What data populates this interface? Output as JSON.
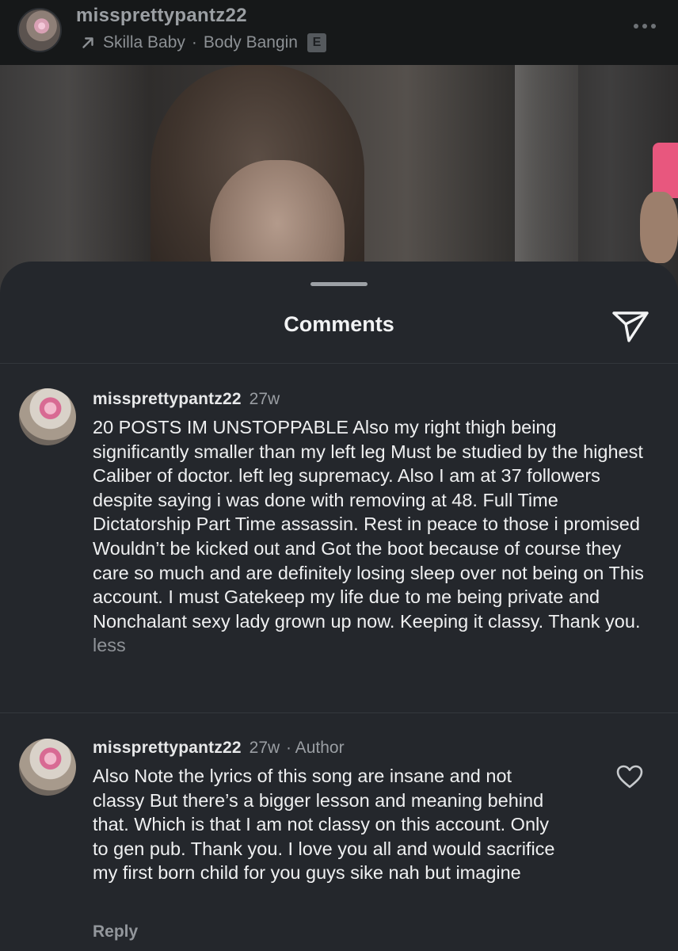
{
  "post": {
    "username": "missprettypantz22",
    "music_artist": "Skilla Baby",
    "music_separator": "·",
    "music_title": "Body Bangin",
    "explicit_badge": "E",
    "icons": {
      "music": "arrow-up-right-icon",
      "more": "more-horizontal-icon"
    }
  },
  "sheet": {
    "title": "Comments",
    "share_icon": "paper-plane-icon"
  },
  "comments": [
    {
      "username": "missprettypantz22",
      "time": "27w",
      "author_tag": "",
      "text": "20 POSTS IM UNSTOPPABLE Also my right thigh being significantly smaller than my left leg Must be studied by the highest Caliber of doctor. left leg supremacy. Also I am at 37 followers despite saying i was done with removing at 48. Full Time Dictatorship Part Time assassin. Rest in peace to those i promised Wouldn’t be kicked out and Got the boot because of course they care so much and are definitely losing sleep over not being on This account. I must Gatekeep my life due to me being private and Nonchalant sexy lady grown up now. Keeping it classy. Thank you.",
      "less_label": "less"
    },
    {
      "username": "missprettypantz22",
      "time": "27w",
      "author_tag": "· Author",
      "text": "Also Note the lyrics of this song are insane and not classy But there’s a bigger lesson and meaning behind that. Which is that I am not classy on this account. Only to gen pub. Thank you. I love you all and would sacrifice my first born child for you guys sike nah but imagine",
      "reply_label": "Reply",
      "like_icon": "heart-icon"
    }
  ],
  "colors": {
    "sheet_background": "#24272c",
    "header_background": "#161819",
    "text_primary": "#eff0f1",
    "text_secondary": "#9a9ea3"
  }
}
